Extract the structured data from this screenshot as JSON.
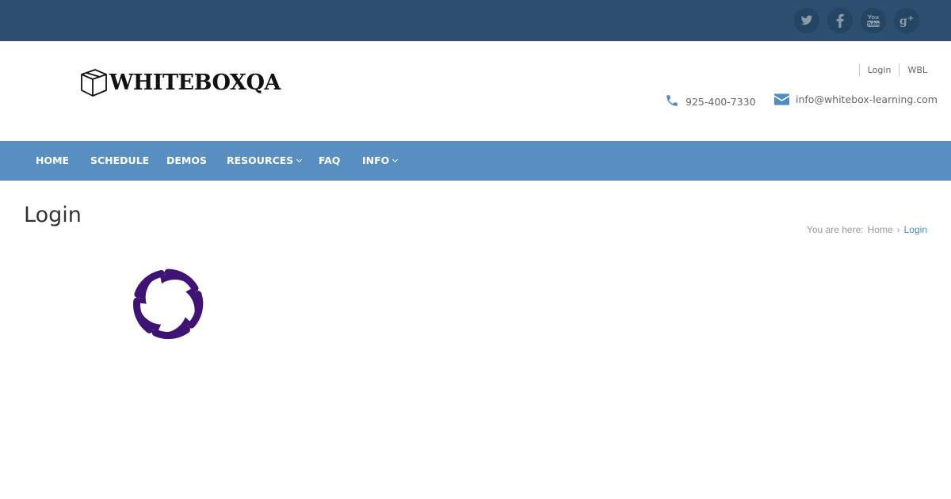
{
  "social": [
    {
      "icon": "twitter-icon"
    },
    {
      "icon": "facebook-icon"
    },
    {
      "icon": "youtube-icon",
      "text": "You"
    },
    {
      "icon": "google-plus-icon",
      "text": "g+"
    }
  ],
  "logo": {
    "text": "WHITEBOXQA",
    "icon": "box-icon"
  },
  "top_links": [
    "Login",
    "WBL"
  ],
  "contact": {
    "phone": "925-400-7330",
    "email": "info@whitebox-learning.com"
  },
  "nav": {
    "items": [
      {
        "label": "HOME"
      },
      {
        "label": "SCHEDULE"
      },
      {
        "label": "DEMOS"
      },
      {
        "label": "RESOURCES",
        "dropdown": true
      },
      {
        "label": "FAQ"
      },
      {
        "label": "INFO",
        "dropdown": true
      }
    ]
  },
  "page": {
    "title": "Login"
  },
  "breadcrumb": {
    "prefix": "You are here:",
    "home": "Home",
    "current": "Login"
  },
  "colors": {
    "topbar": "#2c4f70",
    "nav": "#588fc0",
    "accent": "#4f8dc5",
    "spinner": "#3f1373"
  },
  "loader": {
    "icon": "loading-spinner-icon"
  }
}
